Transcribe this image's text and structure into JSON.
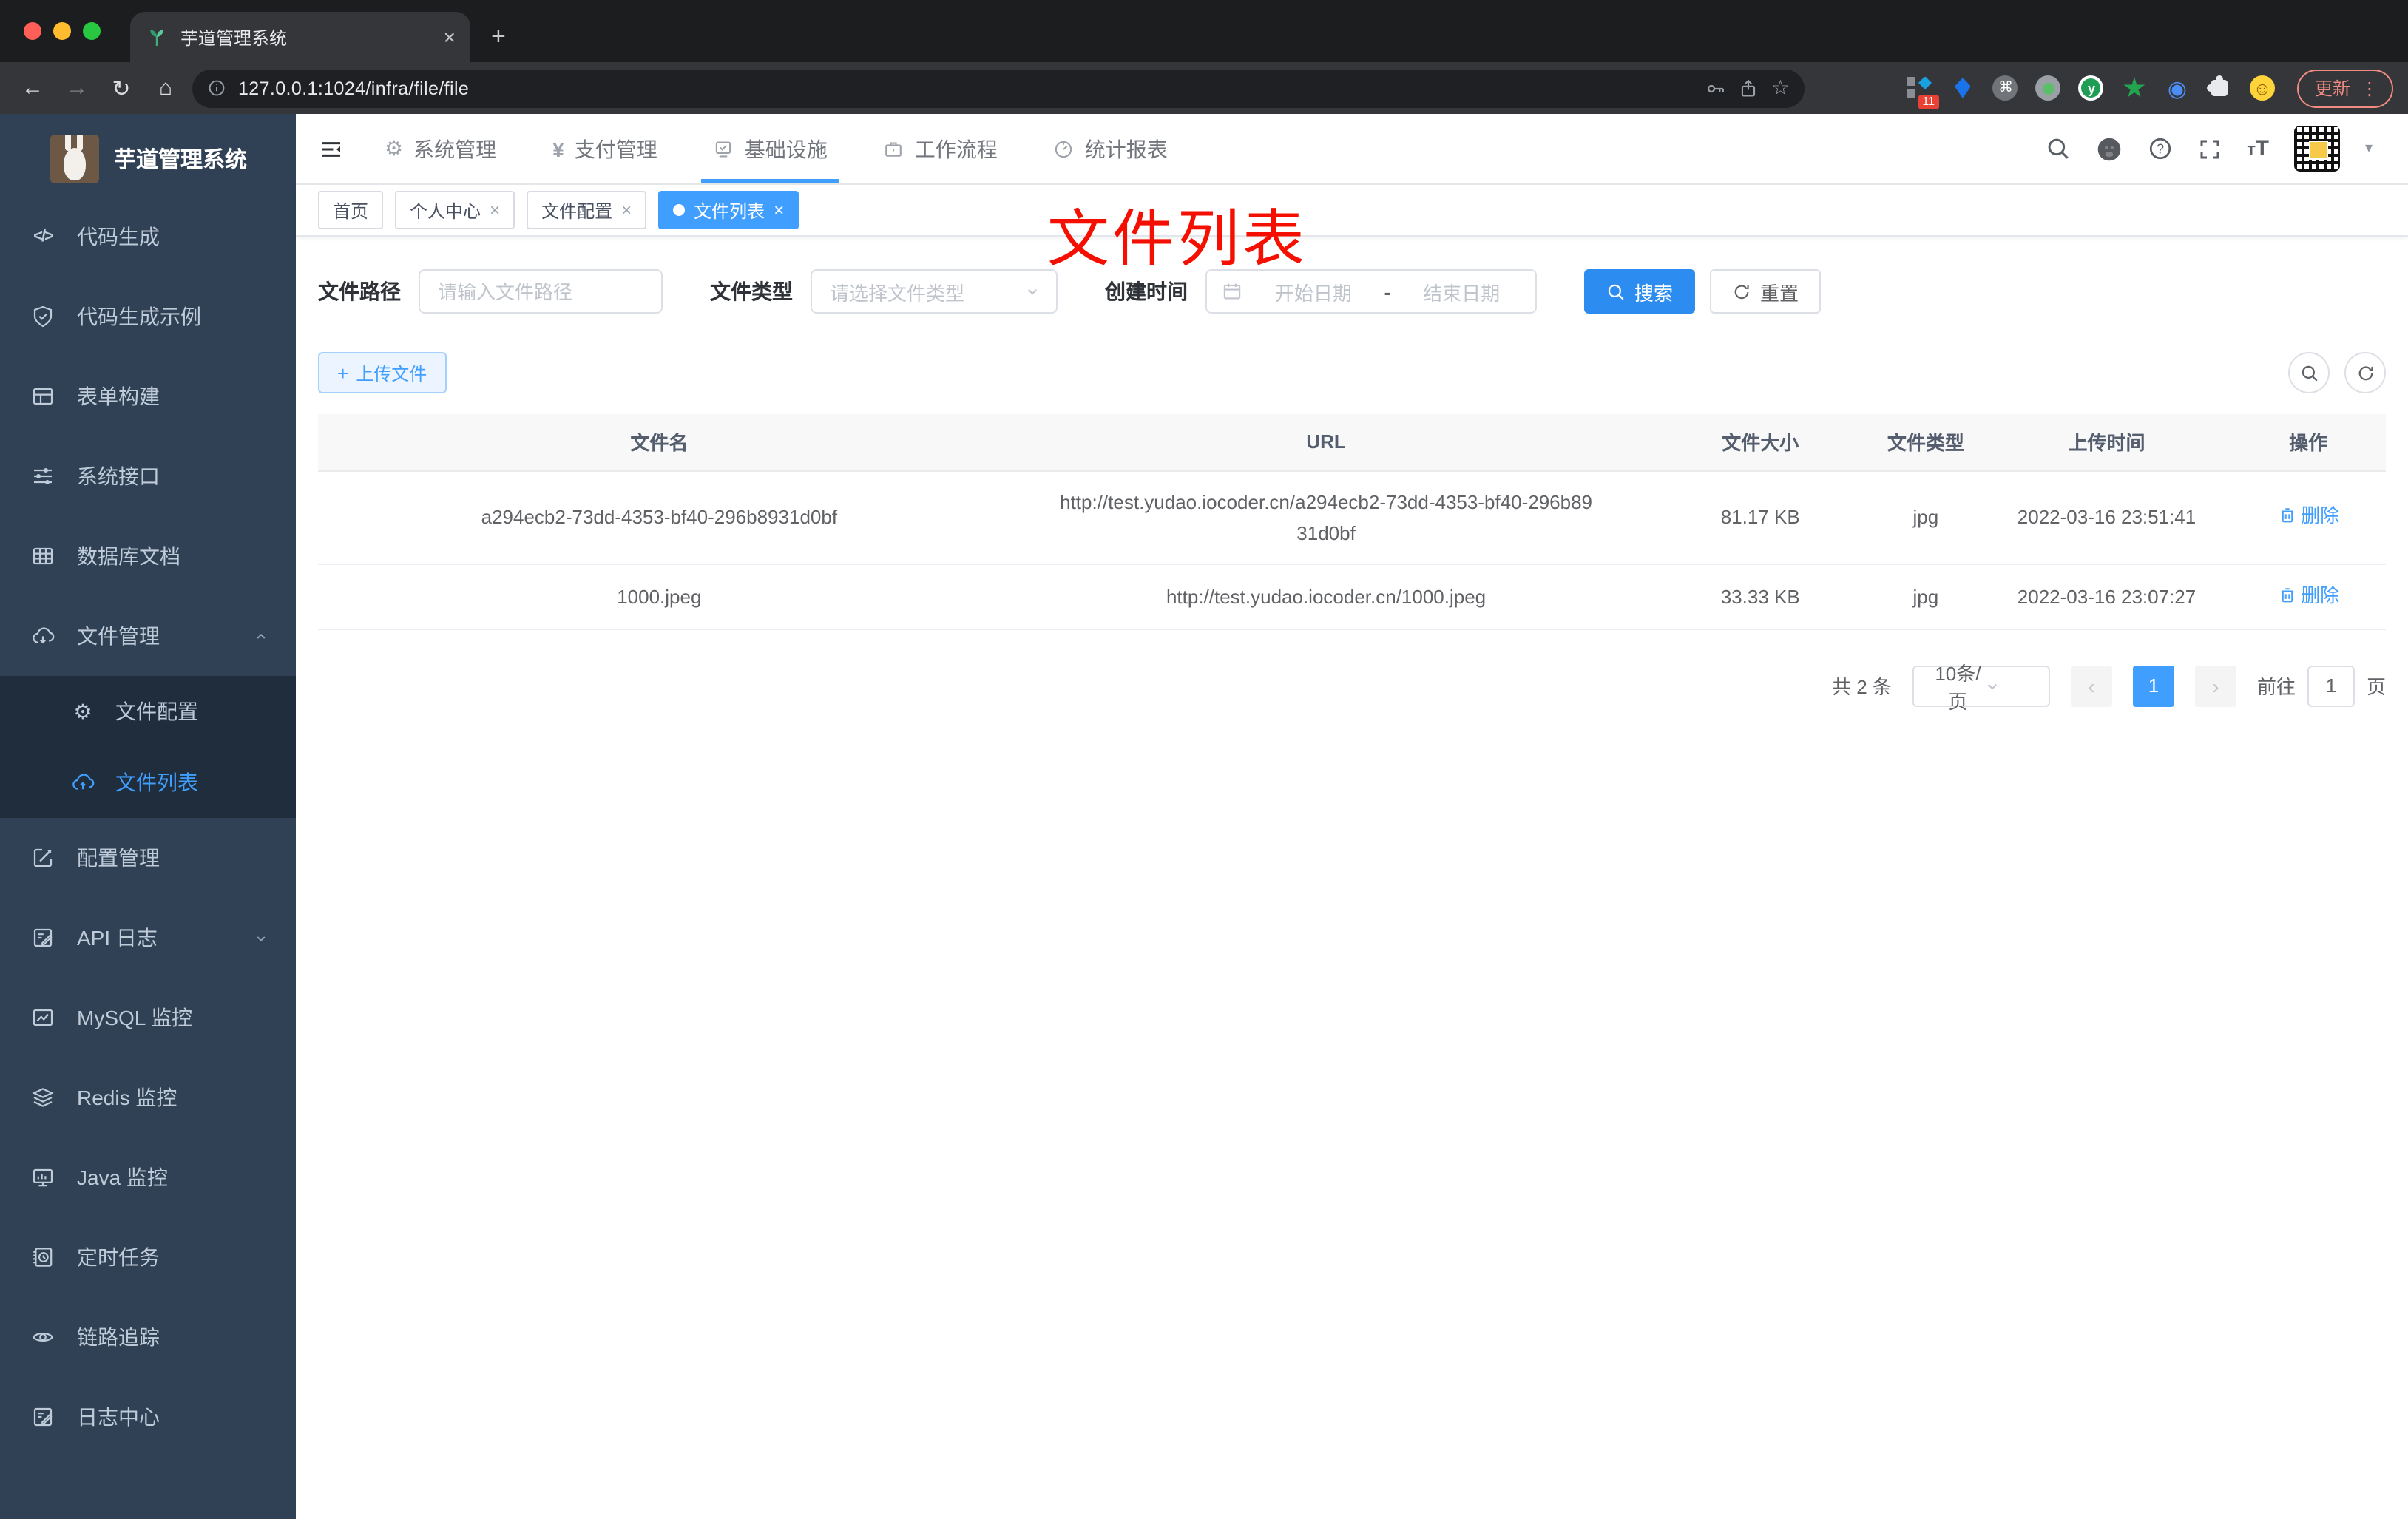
{
  "browser": {
    "tab_title": "芋道管理系统",
    "url": "127.0.0.1:1024/infra/file/file",
    "update_label": "更新",
    "extension_badge": "11"
  },
  "icons": {
    "back": "←",
    "forward": "→",
    "reload": "↻",
    "home": "⌂",
    "star": "☆",
    "plus": "+",
    "close": "×",
    "kebab": "⋮",
    "command": "⌘",
    "smiley": "☺",
    "caret_down": "▾",
    "prev": "‹",
    "next": "›",
    "gear": "⚙",
    "yen": "¥",
    "y_letter": "y",
    "eye": "◉",
    "question": "?"
  },
  "sidebar": {
    "logo_title": "芋道管理系统",
    "items": [
      {
        "label": "代码生成"
      },
      {
        "label": "代码生成示例"
      },
      {
        "label": "表单构建"
      },
      {
        "label": "系统接口"
      },
      {
        "label": "数据库文档"
      },
      {
        "label": "文件管理"
      },
      {
        "label": "文件配置"
      },
      {
        "label": "文件列表"
      },
      {
        "label": "配置管理"
      },
      {
        "label": "API 日志"
      },
      {
        "label": "MySQL 监控"
      },
      {
        "label": "Redis 监控"
      },
      {
        "label": "Java 监控"
      },
      {
        "label": "定时任务"
      },
      {
        "label": "链路追踪"
      },
      {
        "label": "日志中心"
      }
    ]
  },
  "topnav": {
    "items": [
      {
        "label": "系统管理"
      },
      {
        "label": "支付管理"
      },
      {
        "label": "基础设施"
      },
      {
        "label": "工作流程"
      },
      {
        "label": "统计报表"
      }
    ]
  },
  "tags": [
    {
      "label": "首页"
    },
    {
      "label": "个人中心"
    },
    {
      "label": "文件配置"
    },
    {
      "label": "文件列表"
    }
  ],
  "annotation": {
    "text": "文件列表"
  },
  "filters": {
    "path_label": "文件路径",
    "path_placeholder": "请输入文件路径",
    "type_label": "文件类型",
    "type_placeholder": "请选择文件类型",
    "date_label": "创建时间",
    "date_start_placeholder": "开始日期",
    "date_separator": "-",
    "date_end_placeholder": "结束日期",
    "search_label": "搜索",
    "reset_label": "重置"
  },
  "actions": {
    "upload_label": "上传文件"
  },
  "table": {
    "headers": [
      "文件名",
      "URL",
      "文件大小",
      "文件类型",
      "上传时间",
      "操作"
    ],
    "rows": [
      {
        "name": "a294ecb2-73dd-4353-bf40-296b8931d0bf",
        "url": "http://test.yudao.iocoder.cn/a294ecb2-73dd-4353-bf40-296b8931d0bf",
        "size": "81.17 KB",
        "type": "jpg",
        "time": "2022-03-16 23:51:41",
        "action": "删除"
      },
      {
        "name": "1000.jpeg",
        "url": "http://test.yudao.iocoder.cn/1000.jpeg",
        "size": "33.33 KB",
        "type": "jpg",
        "time": "2022-03-16 23:07:27",
        "action": "删除"
      }
    ]
  },
  "pagination": {
    "total": "共 2 条",
    "page_size": "10条/页",
    "current_page": "1",
    "goto_label": "前往",
    "goto_value": "1",
    "goto_unit": "页"
  }
}
